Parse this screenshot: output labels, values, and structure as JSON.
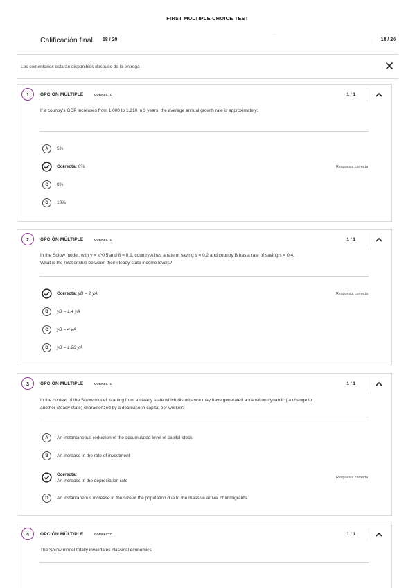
{
  "page": {
    "title": "FIRST MULTIPLE CHOICE TEST"
  },
  "grade": {
    "label": "Calificación final",
    "inline_score": "18 / 20",
    "right_score": "18 / 20",
    "dot_a": "-",
    "dot_b": "."
  },
  "notice": {
    "text": "Los comentarios estarán disponibles después de la entrega",
    "close_icon": "close-icon"
  },
  "questions": [
    {
      "number": "1",
      "type": "OPCIÓN MÚLTIPLE",
      "status": "CORRECTO",
      "score": "1 / 1",
      "text": "If a country's GDP increases from 1,000 to 1,210 in 3 years, the average annual growth rate is approximately:",
      "correct_tag": "Respuesta correcta",
      "options": [
        {
          "letter": "A",
          "text": "5%"
        },
        {
          "prefix": "Correcta:",
          "text": "6%"
        },
        {
          "letter": "C",
          "text": "8%"
        },
        {
          "letter": "D",
          "text": "10%"
        }
      ]
    },
    {
      "number": "2",
      "type": "OPCIÓN MÚLTIPLE",
      "status": "CORRECTO",
      "score": "1 / 1",
      "text_line1": "In the Solow model, with y = k^0.5 and δ = 0.1, country A has a rate of saving  s = 0.2 and country B has a rate of saving s = 0.4.",
      "text_line2": "What is the relationship between their steady-state income levels?",
      "correct_tag": "Respuesta correcta",
      "options": [
        {
          "prefix": "Correcta:",
          "text": "yB = 2 yA"
        },
        {
          "letter": "B",
          "text": "yB = 1.4 yA"
        },
        {
          "letter": "C",
          "text": "yB = 4 yA"
        },
        {
          "letter": "D",
          "text": "yB = 1.26 yA"
        }
      ]
    },
    {
      "number": "3",
      "type": "OPCIÓN MÚLTIPLE",
      "status": "CORRECTO",
      "score": "1 / 1",
      "text_line1": "In the context of the Solow model: starting from a steady state which disturbance may have generated a transition dynamic ( a change to",
      "text_line2": "another steady state) characterized by a decrease in capital per worker?",
      "correct_tag": "Respuesta correcta",
      "options": [
        {
          "letter": "A",
          "text": "An instantaneous reduction of the accumulated level of capital stock"
        },
        {
          "letter": "B",
          "text": "An increase in the rate of investment"
        },
        {
          "prefix": "Correcta:",
          "text": "An increase in the depreciation rate"
        },
        {
          "letter": "D",
          "text": "An instantaneous increase in the size of the population due to the massive arrival of immigrants"
        }
      ]
    },
    {
      "number": "4",
      "type": "OPCIÓN MÚLTIPLE",
      "status": "CORRECTO",
      "score": "1 / 1",
      "text": "The Solow model totally invalidates classical economics"
    }
  ]
}
